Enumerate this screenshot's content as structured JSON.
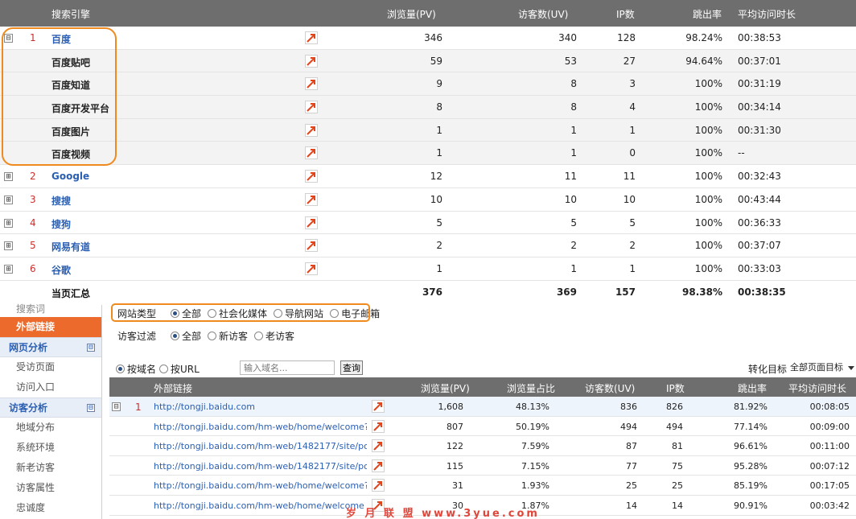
{
  "top_table": {
    "headers": {
      "engine": "搜索引擎",
      "pv": "浏览量(PV)",
      "uv": "访客数(UV)",
      "ip": "IP数",
      "bounce": "跳出率",
      "duration": "平均访问时长"
    },
    "rows": [
      {
        "exp": "⊟",
        "rank": "1",
        "name": "百度",
        "pv": "346",
        "uv": "340",
        "ip": "128",
        "bounce": "98.24%",
        "duration": "00:38:53"
      },
      {
        "name": "百度贴吧",
        "pv": "59",
        "uv": "53",
        "ip": "27",
        "bounce": "94.64%",
        "duration": "00:37:01"
      },
      {
        "name": "百度知道",
        "pv": "9",
        "uv": "8",
        "ip": "3",
        "bounce": "100%",
        "duration": "00:31:19"
      },
      {
        "name": "百度开发平台",
        "pv": "8",
        "uv": "8",
        "ip": "4",
        "bounce": "100%",
        "duration": "00:34:14"
      },
      {
        "name": "百度图片",
        "pv": "1",
        "uv": "1",
        "ip": "1",
        "bounce": "100%",
        "duration": "00:31:30"
      },
      {
        "name": "百度视频",
        "pv": "1",
        "uv": "1",
        "ip": "0",
        "bounce": "100%",
        "duration": "--"
      },
      {
        "exp": "⊞",
        "rank": "2",
        "name": "Google",
        "pv": "12",
        "uv": "11",
        "ip": "11",
        "bounce": "100%",
        "duration": "00:32:43"
      },
      {
        "exp": "⊞",
        "rank": "3",
        "name": "搜搜",
        "pv": "10",
        "uv": "10",
        "ip": "10",
        "bounce": "100%",
        "duration": "00:43:44"
      },
      {
        "exp": "⊞",
        "rank": "4",
        "name": "搜狗",
        "pv": "5",
        "uv": "5",
        "ip": "5",
        "bounce": "100%",
        "duration": "00:36:33"
      },
      {
        "exp": "⊞",
        "rank": "5",
        "name": "网易有道",
        "pv": "2",
        "uv": "2",
        "ip": "2",
        "bounce": "100%",
        "duration": "00:37:07"
      },
      {
        "exp": "⊞",
        "rank": "6",
        "name": "谷歌",
        "pv": "1",
        "uv": "1",
        "ip": "1",
        "bounce": "100%",
        "duration": "00:33:03"
      }
    ],
    "total": {
      "name": "当页汇总",
      "pv": "376",
      "uv": "369",
      "ip": "157",
      "bounce": "98.38%",
      "duration": "00:38:35"
    }
  },
  "sidebar": {
    "faded_item": "搜索词",
    "active_item": "外部链接",
    "sections": [
      {
        "title": "网页分析",
        "collapse": "⊟",
        "items": [
          "受访页面",
          "访问入口"
        ]
      },
      {
        "title": "访客分析",
        "collapse": "⊟",
        "items": [
          "地域分布",
          "系统环境",
          "新老访客",
          "访客属性",
          "忠诚度"
        ]
      }
    ]
  },
  "filters": {
    "site_type": {
      "label": "网站类型",
      "options": [
        "全部",
        "社会化媒体",
        "导航网站",
        "电子邮箱"
      ],
      "selected": 0
    },
    "visitor": {
      "label": "访客过滤",
      "options": [
        "全部",
        "新访客",
        "老访客"
      ],
      "selected": 0
    }
  },
  "search": {
    "by_domain": "按域名",
    "by_url": "按URL",
    "placeholder": "输入域名...",
    "button": "查询",
    "conversion_label": "转化目标",
    "conversion_value": "全部页面目标"
  },
  "bottom_table": {
    "headers": {
      "link": "外部链接",
      "pv": "浏览量(PV)",
      "pct": "浏览量占比",
      "uv": "访客数(UV)",
      "ip": "IP数",
      "bounce": "跳出率",
      "duration": "平均访问时长"
    },
    "rows": [
      {
        "exp": "⊟",
        "rank": "1",
        "url": "http://tongji.baidu.com",
        "pv": "1,608",
        "pct": "48.13%",
        "uv": "836",
        "ip": "826",
        "bounce": "81.92%",
        "duration": "00:08:05"
      },
      {
        "url": "http://tongji.baidu.com/hm-web/home/welcome?site...",
        "pv": "807",
        "pct": "50.19%",
        "uv": "494",
        "ip": "494",
        "bounce": "77.14%",
        "duration": "00:09:00"
      },
      {
        "url": "http://tongji.baidu.com/hm-web/1482177/site/pointclk...",
        "pv": "122",
        "pct": "7.59%",
        "uv": "87",
        "ip": "81",
        "bounce": "96.61%",
        "duration": "00:11:00"
      },
      {
        "url": "http://tongji.baidu.com/hm-web/1482177/site/pointclk...",
        "pv": "115",
        "pct": "7.15%",
        "uv": "77",
        "ip": "75",
        "bounce": "95.28%",
        "duration": "00:07:12"
      },
      {
        "url": "http://tongji.baidu.com/hm-web/home/welcome?site...",
        "pv": "31",
        "pct": "1.93%",
        "uv": "25",
        "ip": "25",
        "bounce": "85.19%",
        "duration": "00:17:05"
      },
      {
        "url": "http://tongji.baidu.com/hm-web/home/welcome",
        "pv": "30",
        "pct": "1.87%",
        "uv": "14",
        "ip": "14",
        "bounce": "90.91%",
        "duration": "00:03:42"
      }
    ]
  },
  "watermark": "岁 月 联 盟  www.3yue.com",
  "colors": {
    "accent": "#ec6a2c",
    "link": "#2b5fb3",
    "highlight": "#ef8a1f",
    "header": "#6e6e6e",
    "rank": "#c8302e"
  }
}
